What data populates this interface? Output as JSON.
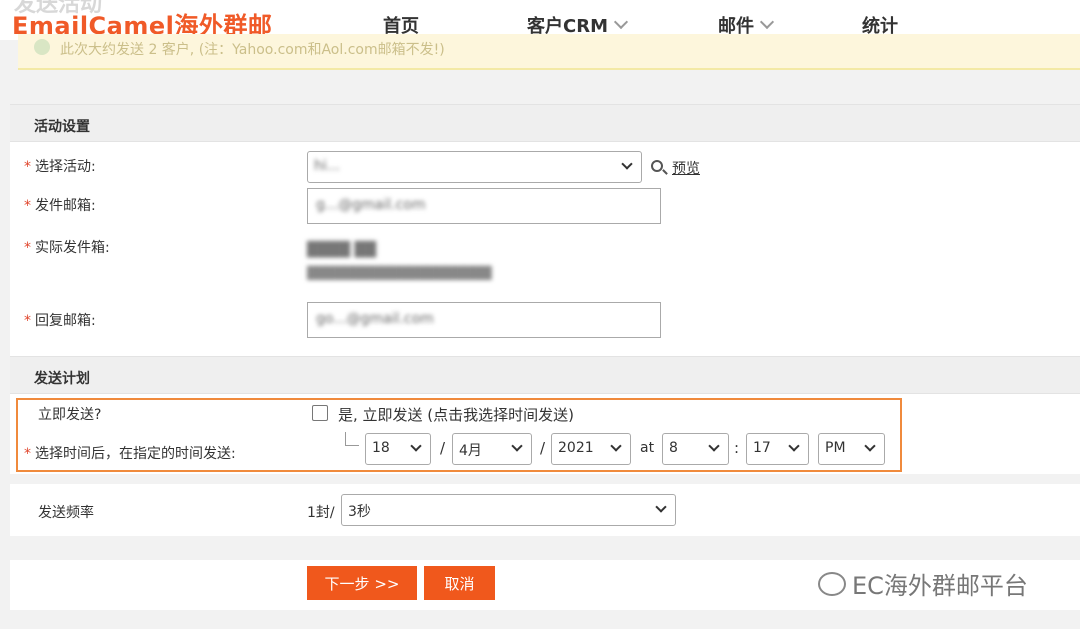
{
  "header": {
    "page_title": "发送活动",
    "brand": "EmailCamel海外群邮",
    "nav": [
      {
        "label": "首页"
      },
      {
        "label": "客户CRM"
      },
      {
        "label": "邮件"
      },
      {
        "label": "统计"
      }
    ]
  },
  "notice": {
    "text": "此次大约发送 2 客户, (注：Yahoo.com和Aol.com邮箱不发!)"
  },
  "activity_settings": {
    "title": "活动设置",
    "required_mark": "*",
    "select_activity_label": "选择活动:",
    "select_activity_value": "hi...",
    "preview_link": "预览",
    "sender_email_label": "发件邮箱:",
    "sender_email_value": "g...@gmail.com",
    "actual_sender_label": "实际发件箱:",
    "actual_sender_line1": "████ ██",
    "actual_sender_line2": "████████████████████",
    "reply_email_label": "回复邮箱:",
    "reply_email_value": "go...@gmail.com"
  },
  "send_plan": {
    "title": "发送计划",
    "send_now_label": "立即发送?",
    "send_now_checkbox_text": "是, 立即发送 (点击我选择时间发送)",
    "schedule_label": "选择时间后，在指定的时间发送:",
    "day": "18",
    "month": "4月",
    "year": "2021",
    "slash": "/",
    "at": "at",
    "colon": ":",
    "hour": "8",
    "minute": "17",
    "ampm": "PM"
  },
  "frequency": {
    "label": "发送频率",
    "prefix": "1封/",
    "value": "3秒"
  },
  "actions": {
    "next_label": "下一步 >>",
    "cancel_label": "取消"
  },
  "watermark": {
    "text": "EC海外群邮平台"
  }
}
